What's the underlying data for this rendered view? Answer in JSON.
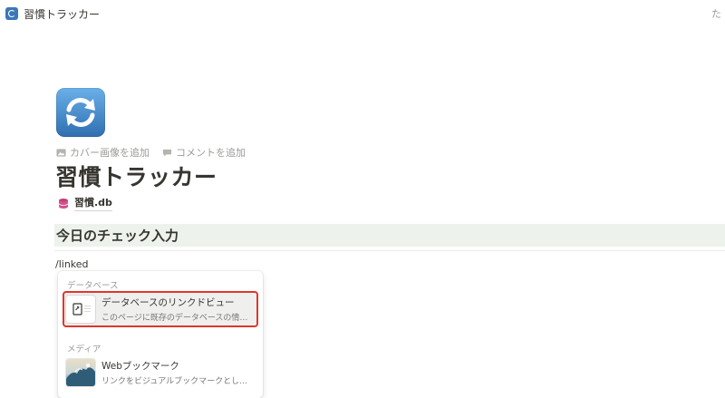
{
  "window": {
    "title": "習慣トラッカー",
    "right_text": "た"
  },
  "page": {
    "icon": "arrows-counterclockwise-icon",
    "actions": [
      {
        "icon": "image-icon",
        "label": "カバー画像を追加"
      },
      {
        "icon": "comment-icon",
        "label": "コメントを追加"
      }
    ],
    "title": "習慣トラッカー",
    "db_link": {
      "icon": "database-icon",
      "label": "習慣.db"
    },
    "section_heading": "今日のチェック入力",
    "slash_command": "/linked"
  },
  "slash_menu": {
    "groups": [
      {
        "label": "データベース",
        "items": [
          {
            "title": "データベースのリンクドビュー",
            "description": "このページに既存のデータベースの情報を...",
            "selected": true
          }
        ]
      },
      {
        "label": "メディア",
        "items": [
          {
            "title": "Webブックマーク",
            "description": "リンクをビジュアルブックマークとして保...",
            "selected": false
          }
        ]
      }
    ]
  },
  "colors": {
    "heading_bg": "#edf3ec",
    "highlight_outline": "#e0362c",
    "text": "#37352f",
    "muted": "#9b9a97"
  }
}
